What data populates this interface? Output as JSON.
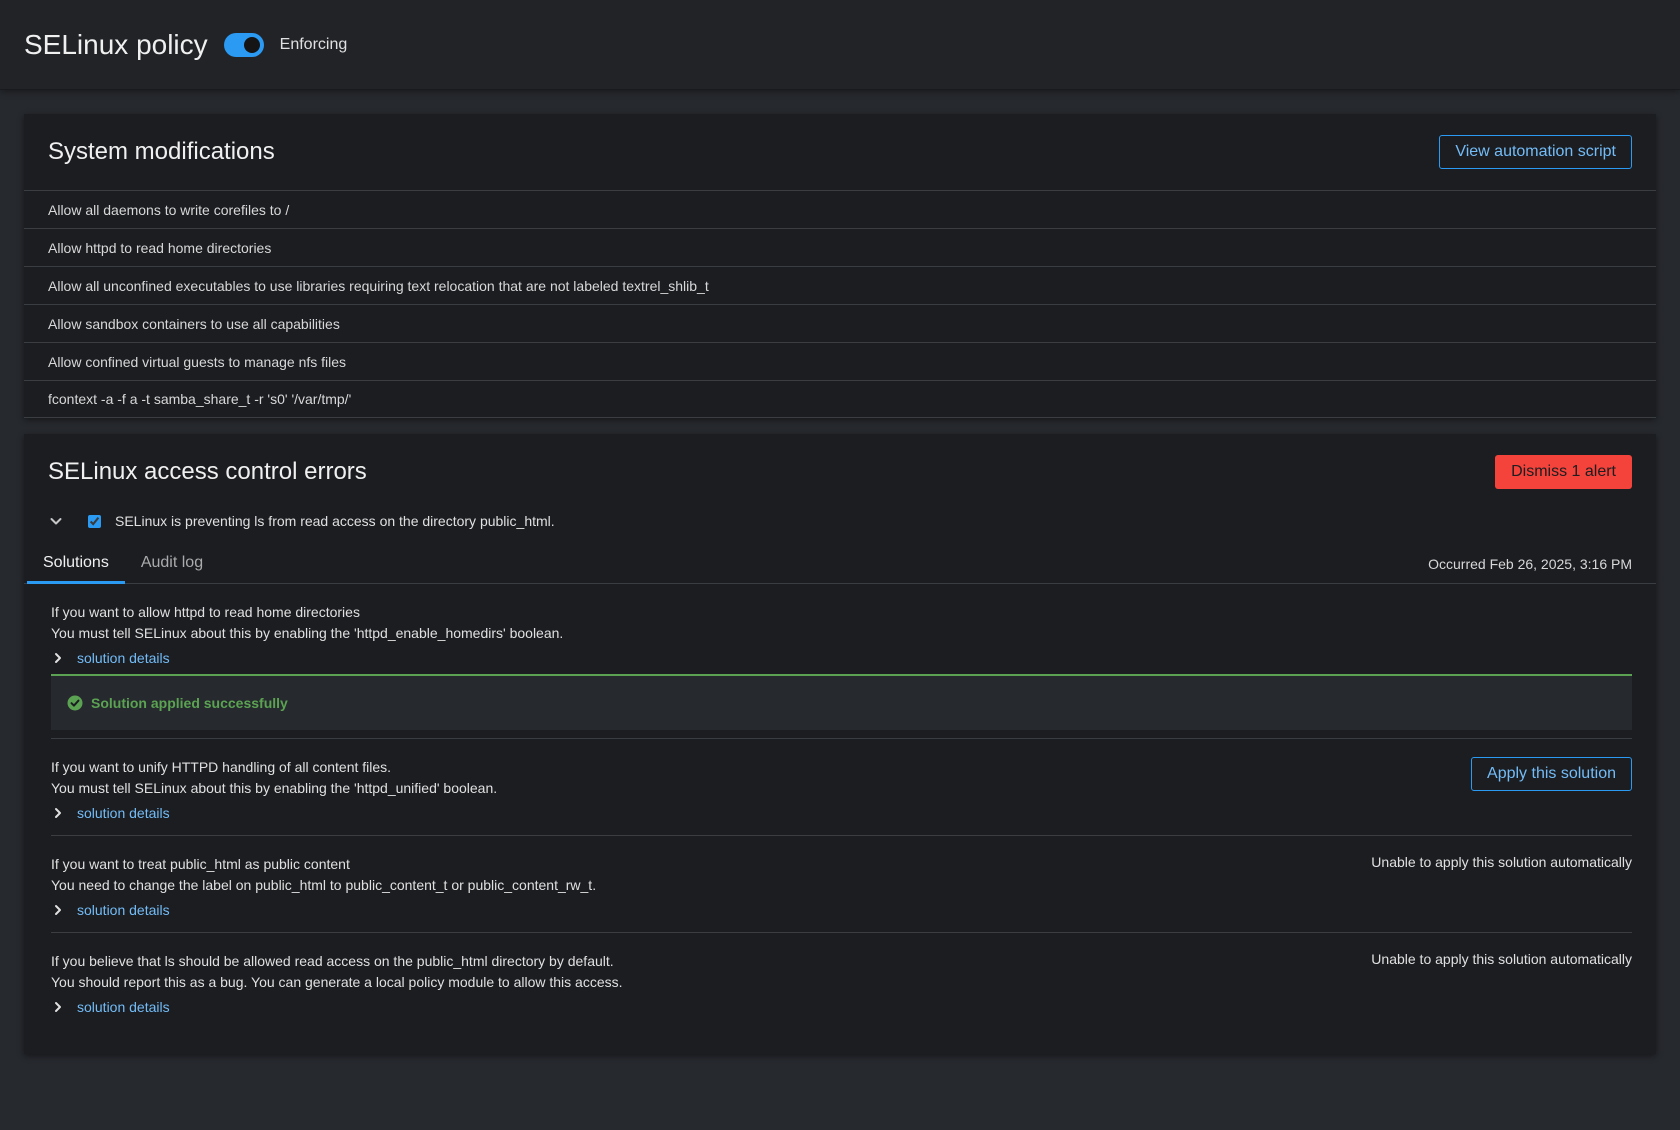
{
  "header": {
    "title": "SELinux policy",
    "toggle_label": "Enforcing",
    "toggle_on": true
  },
  "modifications": {
    "title": "System modifications",
    "script_button": "View automation script",
    "items": [
      "Allow all daemons to write corefiles to /",
      "Allow httpd to read home directories",
      "Allow all unconfined executables to use libraries requiring text relocation that are not labeled textrel_shlib_t",
      "Allow sandbox containers to use all capabilities",
      "Allow confined virtual guests to manage nfs files",
      "fcontext -a -f a -t samba_share_t -r 's0' '/var/tmp/'"
    ]
  },
  "errors": {
    "title": "SELinux access control errors",
    "dismiss_button": "Dismiss 1 alert",
    "alert_text": "SELinux is preventing ls from read access on the directory public_html.",
    "tabs": [
      "Solutions",
      "Audit log"
    ],
    "occurred": "Occurred Feb 26, 2025, 3:16 PM",
    "details_label": "solution details",
    "success_message": "Solution applied successfully",
    "solutions": [
      {
        "line1": "If you want to allow httpd to read home directories",
        "line2": "You must tell SELinux about this by enabling the 'httpd_enable_homedirs' boolean."
      },
      {
        "line1": "If you want to unify HTTPD handling of all content files.",
        "line2": "You must tell SELinux about this by enabling the 'httpd_unified' boolean.",
        "action": "Apply this solution"
      },
      {
        "line1": "If you want to treat public_html as public content",
        "line2": "You need to change the label on public_html to public_content_t or public_content_rw_t.",
        "status": "Unable to apply this solution automatically"
      },
      {
        "line1": "If you believe that ls should be allowed read access on the public_html directory by default.",
        "line2": "You should report this as a bug. You can generate a local policy module to allow this access.",
        "status": "Unable to apply this solution automatically"
      }
    ]
  },
  "colors": {
    "accent": "#2b9af3",
    "link": "#73bcf7",
    "danger": "#f4433b",
    "success": "#5ba352"
  }
}
